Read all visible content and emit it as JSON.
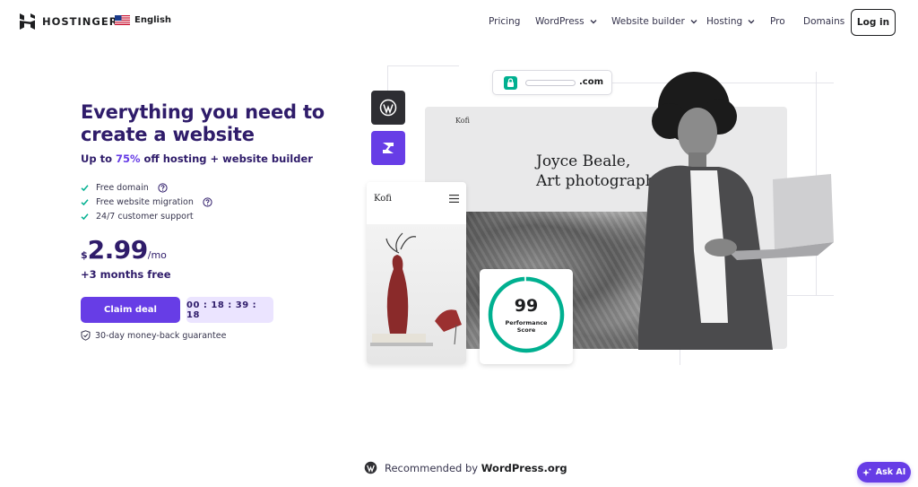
{
  "header": {
    "logo_text": "HOSTINGER",
    "language": "English",
    "nav": [
      {
        "label": "Pricing",
        "has_dropdown": false
      },
      {
        "label": "WordPress",
        "has_dropdown": true
      },
      {
        "label": "Website builder",
        "has_dropdown": true
      },
      {
        "label": "Hosting",
        "has_dropdown": true
      },
      {
        "label": "Pro",
        "has_dropdown": false
      },
      {
        "label": "Domains",
        "has_dropdown": false
      }
    ],
    "login_label": "Log in"
  },
  "hero": {
    "title": "Everything you need to create a website",
    "subtitle_prefix": "Up to ",
    "subtitle_discount": "75%",
    "subtitle_suffix": " off hosting + website builder",
    "features": [
      {
        "label": "Free domain",
        "has_help": true
      },
      {
        "label": "Free website migration",
        "has_help": true
      },
      {
        "label": "24/7 customer support",
        "has_help": false
      }
    ],
    "price_currency": "$",
    "price_amount": "2.99",
    "price_period": "/mo",
    "bonus": "+3 months free",
    "claim_label": "Claim deal",
    "timer": "00 : 18 : 39 : 18",
    "guarantee": "30-day money-back guarantee"
  },
  "illustration": {
    "url_suffix": ".com",
    "site_logo": "Kofi",
    "site_heading": "Joyce Beale,\nArt photograph",
    "mobile_logo": "Kofi",
    "perf_score": "99",
    "perf_label_line1": "Performance",
    "perf_label_line2": "Score"
  },
  "footer": {
    "recommended_prefix": "Recommended by ",
    "recommended_brand": "WordPress.org",
    "ask_ai_label": "Ask AI"
  },
  "colors": {
    "brand": "#673de6",
    "heading": "#2f1c6a",
    "check": "#00b090",
    "timer_bg": "#ebe4ff"
  },
  "icons": [
    "hostinger-logo-icon",
    "us-flag-icon",
    "chevron-down-icon",
    "check-icon",
    "help-circle-icon",
    "shield-check-icon",
    "lock-icon",
    "wordpress-icon",
    "website-builder-icon",
    "hamburger-menu-icon",
    "sparkle-icon"
  ]
}
